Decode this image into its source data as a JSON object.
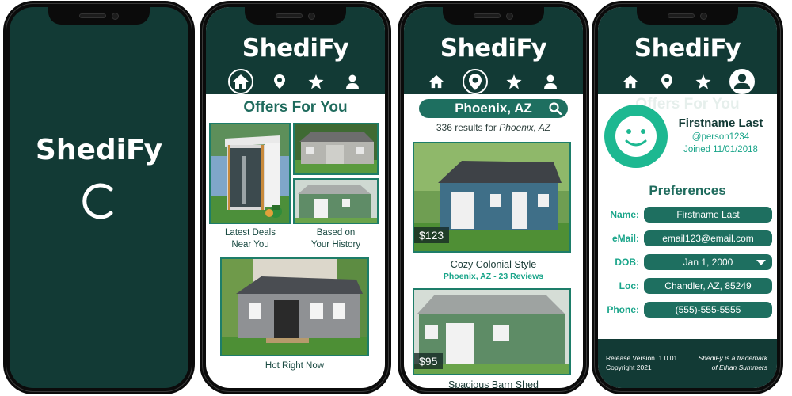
{
  "app_name": "ShediFy",
  "colors": {
    "brand_dark": "#123a35",
    "brand_mid": "#1e6f60",
    "accent": "#1aa58a",
    "avatar": "#1db891"
  },
  "nav": [
    {
      "icon": "home-icon"
    },
    {
      "icon": "location-pin-icon"
    },
    {
      "icon": "star-icon"
    },
    {
      "icon": "user-icon"
    }
  ],
  "splash": {
    "title": "ShediFy"
  },
  "offers": {
    "title": "Offers For You",
    "tiles": [
      {
        "caption": "Latest Deals\nNear You"
      },
      {
        "caption": "Based on\nYour History"
      },
      {
        "caption": "Hot Right Now"
      }
    ]
  },
  "search": {
    "query": "Phoenix, AZ",
    "result_count_prefix": "336 results for ",
    "result_location": "Phoenix, AZ",
    "listings": [
      {
        "price": "$123",
        "title": "Cozy Colonial Style",
        "subtitle": "Phoenix, AZ - 23 Reviews"
      },
      {
        "price": "$95",
        "title": "Spacious Barn Shed"
      }
    ]
  },
  "profile": {
    "ghost_title": "Offers For You",
    "name": "Firstname Last",
    "handle": "@person1234",
    "joined": "Joined 11/01/2018",
    "preferences_title": "Preferences",
    "fields": [
      {
        "label": "Name:",
        "value": "Firstname Last"
      },
      {
        "label": "eMail:",
        "value": "email123@email.com"
      },
      {
        "label": "DOB:",
        "value": "Jan 1, 2000",
        "dropdown": true
      },
      {
        "label": "Loc:",
        "value": "Chandler, AZ, 85249"
      },
      {
        "label": "Phone:",
        "value": "(555)-555-5555"
      }
    ],
    "footer": {
      "release": "Release Version. 1.0.01",
      "copyright": "Copyright 2021",
      "trademark_1": "ShediFy is a trademark",
      "trademark_2": "of Ethan Summers"
    }
  }
}
